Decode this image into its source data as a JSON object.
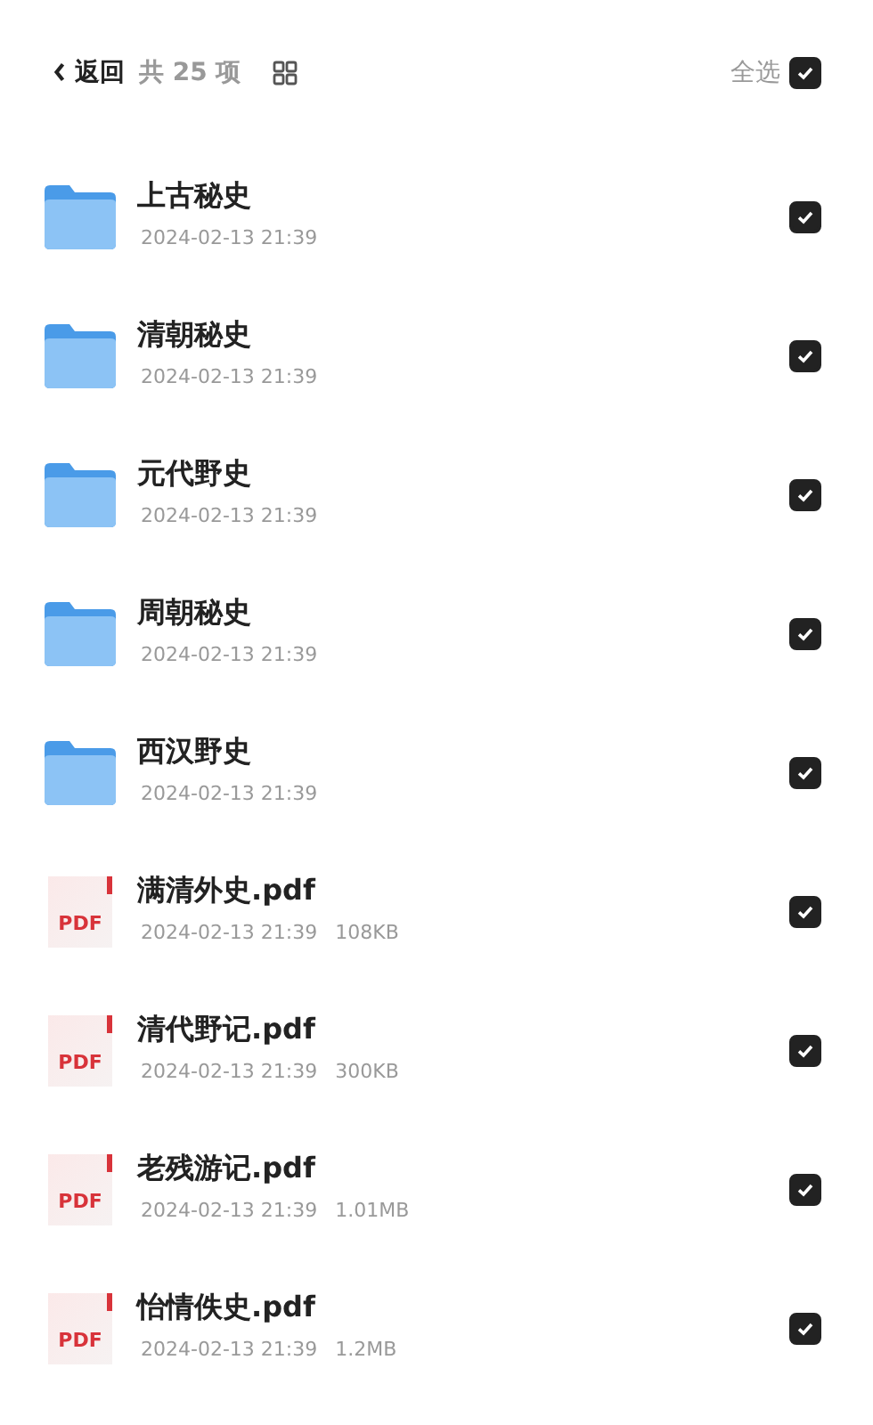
{
  "header": {
    "back": "返回",
    "count": "共 25 项",
    "select_all": {
      "label": "全选",
      "checked": true
    }
  },
  "files": [
    {
      "kind": "folder",
      "name": "上古秘史",
      "meta": "2024-02-13 21:39",
      "checked": true
    },
    {
      "kind": "folder",
      "name": "清朝秘史",
      "meta": "2024-02-13 21:39",
      "checked": true
    },
    {
      "kind": "folder",
      "name": "元代野史",
      "meta": "2024-02-13 21:39",
      "checked": true
    },
    {
      "kind": "folder",
      "name": "周朝秘史",
      "meta": "2024-02-13 21:39",
      "checked": true
    },
    {
      "kind": "folder",
      "name": "西汉野史",
      "meta": "2024-02-13 21:39",
      "checked": true
    },
    {
      "kind": "pdf",
      "badge": "PDF",
      "name": "满清外史.pdf",
      "meta": "2024-02-13 21:39",
      "size": "108KB",
      "checked": true
    },
    {
      "kind": "pdf",
      "badge": "PDF",
      "name": "清代野记.pdf",
      "meta": "2024-02-13 21:39",
      "size": "300KB",
      "checked": true
    },
    {
      "kind": "pdf",
      "badge": "PDF",
      "name": "老残游记.pdf",
      "meta": "2024-02-13 21:39",
      "size": "1.01MB",
      "checked": true
    },
    {
      "kind": "pdf",
      "badge": "PDF",
      "name": "怡情佚史.pdf",
      "meta": "2024-02-13 21:39",
      "size": "1.2MB",
      "checked": true
    }
  ]
}
